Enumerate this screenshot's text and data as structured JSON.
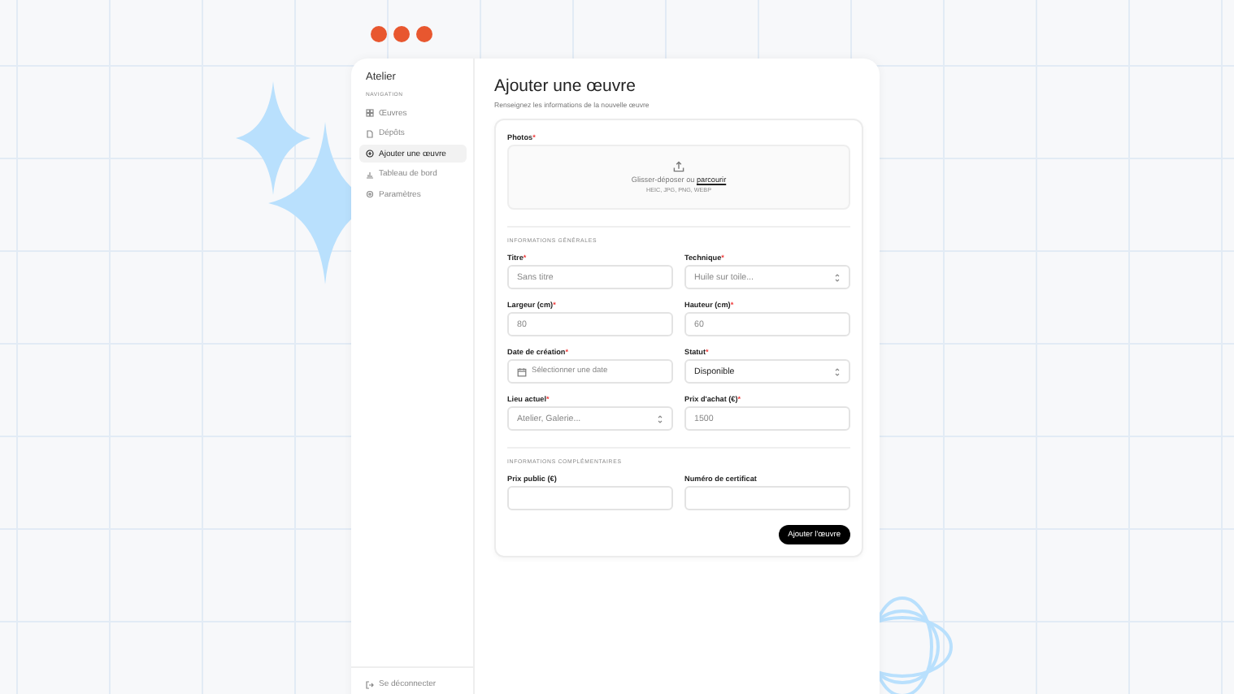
{
  "sidebar": {
    "title": "Atelier",
    "section": "NAVIGATION",
    "items": [
      {
        "label": "Œuvres",
        "selected": false
      },
      {
        "label": "Dépôts",
        "selected": false
      },
      {
        "label": "Ajouter une œuvre",
        "selected": true
      },
      {
        "label": "Tableau de bord",
        "selected": false
      },
      {
        "label": "Paramètres",
        "selected": false
      }
    ],
    "logout": "Se déconnecter"
  },
  "page": {
    "title": "Ajouter une œuvre",
    "subtitle": "Renseignez les informations de la nouvelle œuvre"
  },
  "required_mark": "*",
  "photos": {
    "label": "Photos",
    "required": true,
    "prompt": "Glisser-déposer ou ",
    "link": "parcourir",
    "formats": "HEIC, JPG, PNG, WEBP"
  },
  "sections": [
    {
      "title": "INFORMATIONS GÉNÉRALES",
      "fields": [
        {
          "label": "Titre",
          "required": true,
          "kind": "text",
          "placeholder": "Sans titre"
        },
        {
          "label": "Technique",
          "required": true,
          "kind": "select",
          "placeholder": "Huile sur toile..."
        },
        {
          "label": "Largeur (cm)",
          "required": true,
          "kind": "text",
          "placeholder": "80"
        },
        {
          "label": "Hauteur (cm)",
          "required": true,
          "kind": "text",
          "placeholder": "60"
        },
        {
          "label": "Date de création",
          "required": true,
          "kind": "date",
          "placeholder": "Sélectionner une date"
        },
        {
          "label": "Statut",
          "required": true,
          "kind": "select",
          "value": "Disponible"
        },
        {
          "label": "Lieu actuel",
          "required": true,
          "kind": "select",
          "placeholder": "Atelier, Galerie..."
        },
        {
          "label": "Prix d'achat (€)",
          "required": true,
          "kind": "text",
          "placeholder": "1500"
        }
      ]
    },
    {
      "title": "INFORMATIONS COMPLÉMENTAIRES",
      "fields": [
        {
          "label": "Prix public (€)",
          "required": false,
          "kind": "text"
        },
        {
          "label": "Numéro de certificat",
          "required": false,
          "kind": "text"
        }
      ]
    }
  ],
  "submit": "Ajouter l'œuvre"
}
